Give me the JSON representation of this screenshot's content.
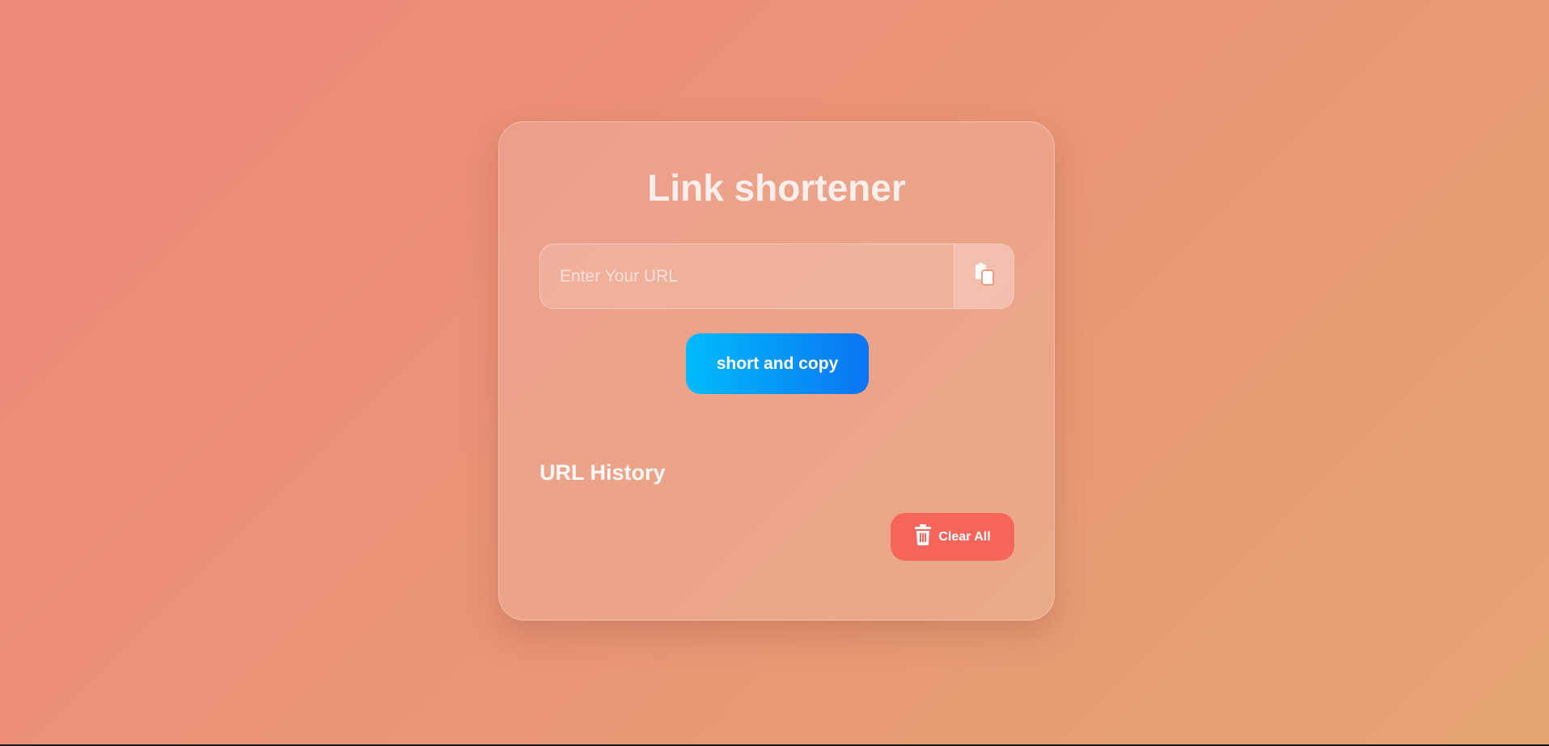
{
  "app": {
    "title": "Link shortener"
  },
  "form": {
    "url_placeholder": "Enter Your URL",
    "url_value": "",
    "paste_icon": "paste-icon",
    "submit_label": "short and copy"
  },
  "history": {
    "title": "URL History",
    "items": [],
    "clear_label": "Clear All",
    "clear_icon": "trash-icon"
  },
  "colors": {
    "background_start": "#ee8879",
    "background_end": "#e5a472",
    "button_gradient_start": "#00bbfc",
    "button_gradient_end": "#0a74f3",
    "clear_button": "#f7645a"
  }
}
